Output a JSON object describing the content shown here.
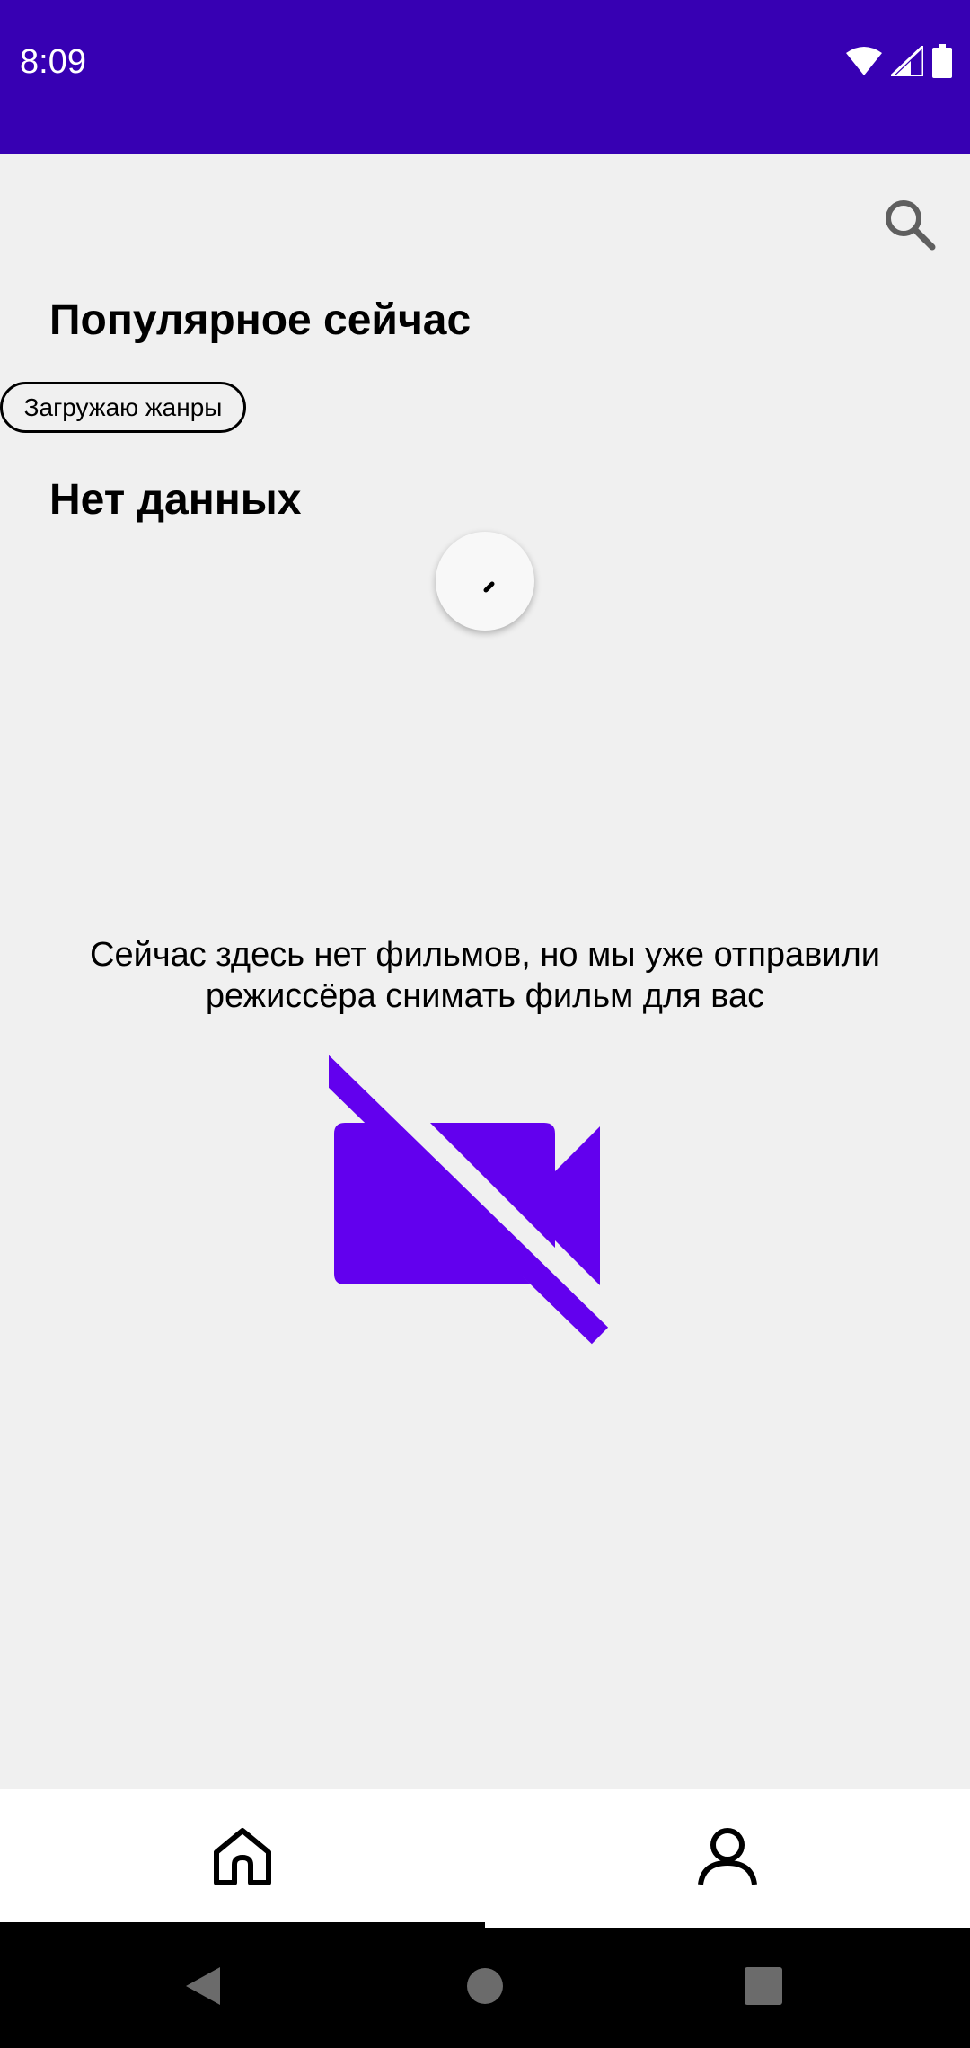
{
  "status_bar": {
    "time": "8:09",
    "background": "#3700b3",
    "icons": [
      "wifi-icon",
      "cell-signal-icon",
      "battery-icon"
    ]
  },
  "toolbar": {
    "search_icon": "search-icon"
  },
  "popular": {
    "title": "Популярное сейчас",
    "genre_chip": "Загружаю жанры"
  },
  "no_data": {
    "title": "Нет данных",
    "loading_icon": "progress-spinner-icon"
  },
  "empty_state": {
    "message": "Сейчас здесь нет фильмов, но мы уже отправили режиссёра снимать фильм для вас",
    "icon": "videocam-off-icon",
    "icon_color": "#6200ee"
  },
  "bottom_nav": {
    "items": [
      {
        "icon": "home-icon",
        "selected": true
      },
      {
        "icon": "person-icon",
        "selected": false
      }
    ]
  },
  "system_nav": {
    "buttons": [
      "back-icon",
      "home-circle-icon",
      "recents-icon"
    ]
  }
}
